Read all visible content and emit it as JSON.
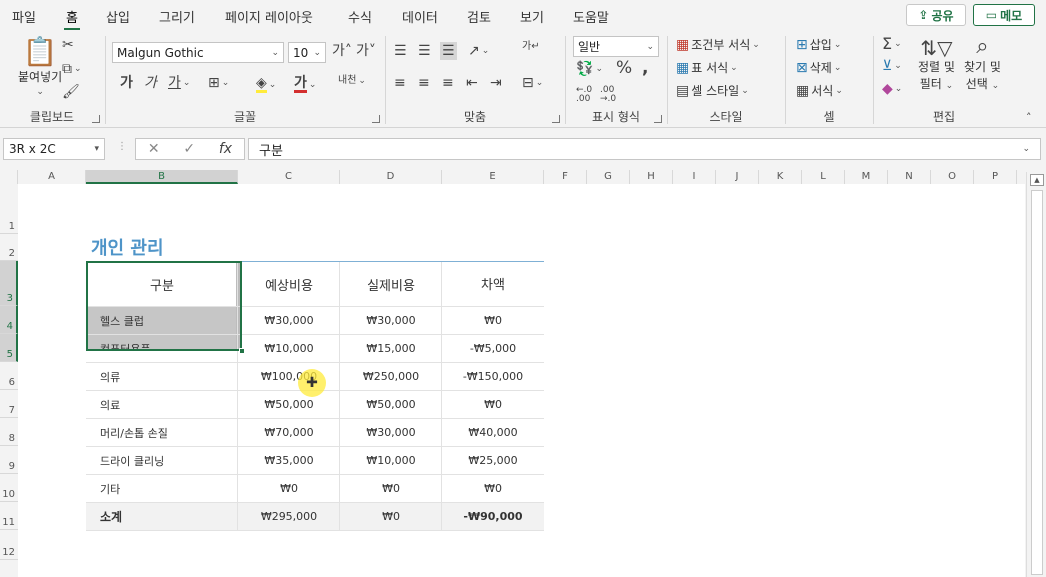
{
  "menu": {
    "tabs": [
      "파일",
      "홈",
      "삽입",
      "그리기",
      "페이지 레이아웃",
      "수식",
      "데이터",
      "검토",
      "보기",
      "도움말"
    ],
    "active": "홈",
    "share_label": "공유",
    "memo_label": "메모"
  },
  "ribbon": {
    "clipboard": {
      "label": "클립보드",
      "paste": "붙여넣기"
    },
    "font": {
      "label": "글꼴",
      "font_name": "Malgun Gothic",
      "font_size": "10"
    },
    "alignment": {
      "label": "맞춤"
    },
    "number": {
      "label": "표시 형식",
      "format": "일반"
    },
    "styles": {
      "label": "스타일",
      "conditional": "조건부 서식",
      "table": "표 서식",
      "cell_style": "셀 스타일"
    },
    "cells": {
      "label": "셀",
      "insert": "삽입",
      "delete": "삭제",
      "format": "서식"
    },
    "editing": {
      "label": "편집",
      "sort_filter_1": "정렬 및",
      "sort_filter_2": "필터",
      "find_select_1": "찾기 및",
      "find_select_2": "선택"
    }
  },
  "formula_bar": {
    "name_box": "3R x 2C",
    "formula": "구분"
  },
  "columns": [
    "A",
    "B",
    "C",
    "D",
    "E",
    "F",
    "G",
    "H",
    "I",
    "J",
    "K",
    "L",
    "M",
    "N",
    "O",
    "P"
  ],
  "rows": [
    "1",
    "2",
    "3",
    "4",
    "5",
    "6",
    "7",
    "8",
    "9",
    "10",
    "11",
    "12"
  ],
  "sheet": {
    "title": "개인 관리",
    "headers": [
      "구분",
      "예상비용",
      "실제비용",
      "차액"
    ],
    "rows": [
      [
        "헬스 클럽",
        "₩30,000",
        "₩30,000",
        "₩0"
      ],
      [
        "컴퓨터용품",
        "₩10,000",
        "₩15,000",
        "-₩5,000"
      ],
      [
        "의류",
        "₩100,000",
        "₩250,000",
        "-₩150,000"
      ],
      [
        "의료",
        "₩50,000",
        "₩50,000",
        "₩0"
      ],
      [
        "머리/손톱 손질",
        "₩70,000",
        "₩30,000",
        "₩40,000"
      ],
      [
        "드라이 클리닝",
        "₩35,000",
        "₩10,000",
        "₩25,000"
      ],
      [
        "기타",
        "₩0",
        "₩0",
        "₩0"
      ]
    ],
    "total": [
      "소계",
      "₩295,000",
      "₩0",
      "-₩90,000"
    ]
  },
  "colors": {
    "accent": "#217346",
    "title": "#4e94c8"
  }
}
